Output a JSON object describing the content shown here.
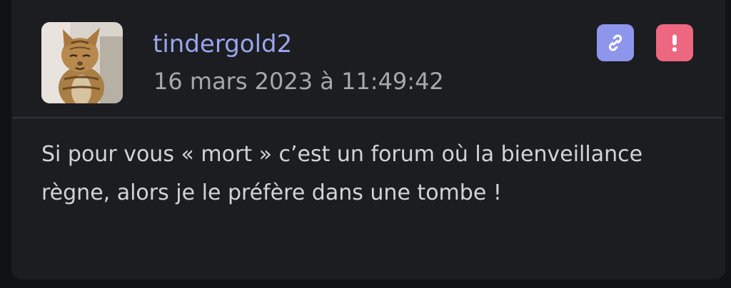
{
  "post": {
    "username": "tindergold2",
    "timestamp": "16 mars 2023 à 11:49:42",
    "message": "Si pour vous « mort » c’est un forum où la bienveillance règne, alors je le préfère dans une tombe !"
  },
  "actions": {
    "link_icon": "link-icon",
    "report_icon": "exclamation-icon"
  },
  "colors": {
    "background": "#1c1d21",
    "username": "#9aa6ec",
    "link_button": "#8e96ec",
    "report_button": "#ee6780"
  }
}
